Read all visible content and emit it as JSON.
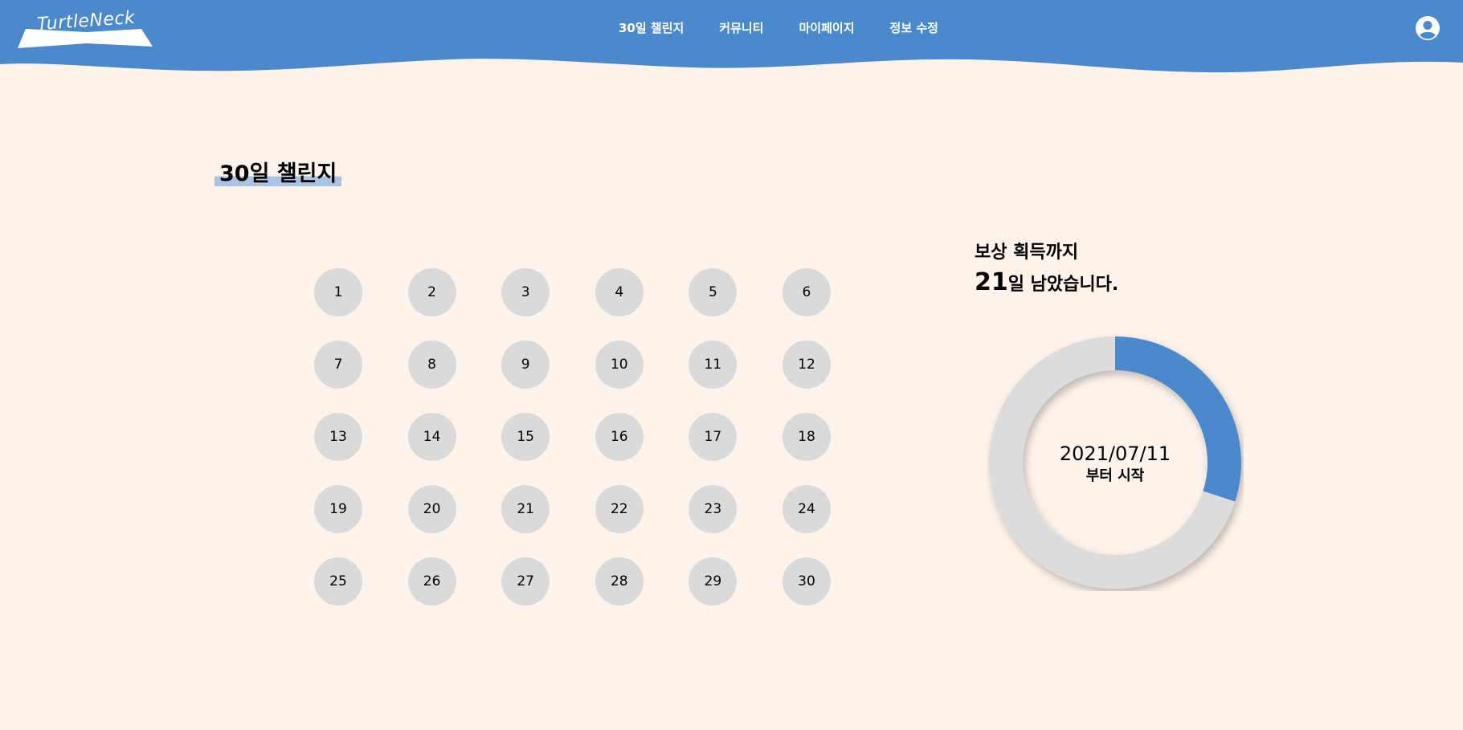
{
  "header": {
    "logo_text": "TurtleNeck",
    "nav": [
      {
        "label": "30일 챌린지"
      },
      {
        "label": "커뮤니티"
      },
      {
        "label": "마이페이지"
      },
      {
        "label": "정보 수정"
      }
    ],
    "profile_icon": "user-circle-icon",
    "color": "#4a89cc"
  },
  "main": {
    "title": "30일 챌린지",
    "days": [
      "1",
      "2",
      "3",
      "4",
      "5",
      "6",
      "7",
      "8",
      "9",
      "10",
      "11",
      "12",
      "13",
      "14",
      "15",
      "16",
      "17",
      "18",
      "19",
      "20",
      "21",
      "22",
      "23",
      "24",
      "25",
      "26",
      "27",
      "28",
      "29",
      "30"
    ]
  },
  "reward": {
    "line1": "보상 획득까지",
    "days_left": "21",
    "line2_suffix": "일 남았습니다."
  },
  "progress": {
    "completed_fraction": 0.3,
    "start_date": "2021/07/11",
    "start_label": "부터 시작",
    "fill_color": "#4a89cc",
    "track_color": "#dcdcdc"
  }
}
